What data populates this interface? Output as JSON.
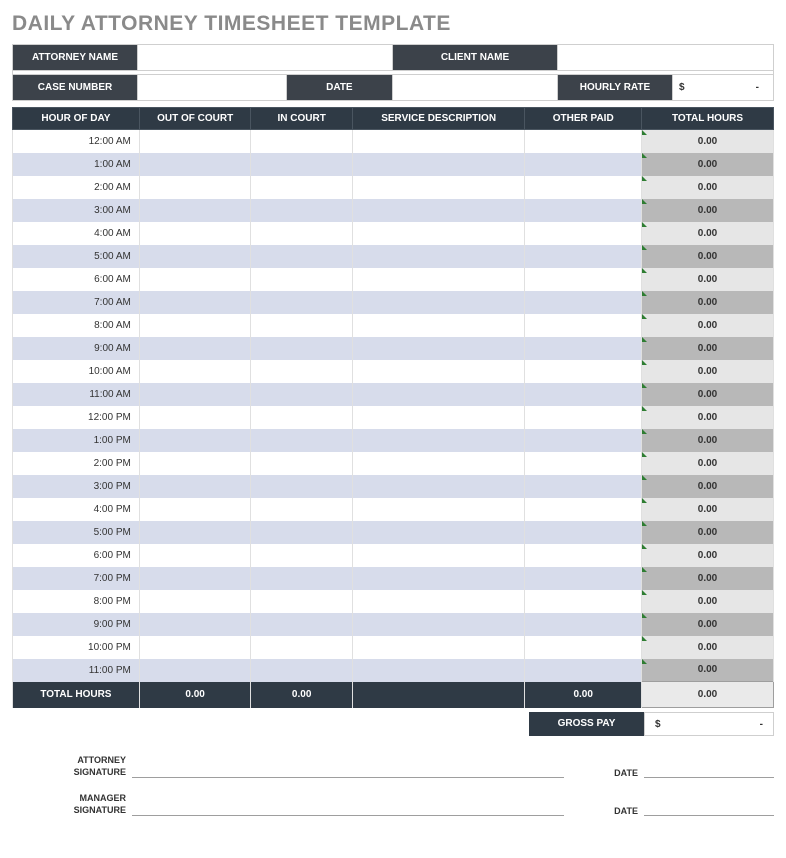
{
  "title": "DAILY ATTORNEY TIMESHEET TEMPLATE",
  "header": {
    "attorney_name_label": "ATTORNEY NAME",
    "client_name_label": "CLIENT NAME",
    "case_number_label": "CASE NUMBER",
    "date_label": "DATE",
    "hourly_rate_label": "HOURLY RATE",
    "hourly_rate_currency": "$",
    "hourly_rate_value": "-",
    "attorney_name_value": "",
    "client_name_value": "",
    "case_number_value": "",
    "date_value": ""
  },
  "columns": {
    "hour": "HOUR OF DAY",
    "out": "OUT OF COURT",
    "in": "IN COURT",
    "desc": "SERVICE DESCRIPTION",
    "other": "OTHER PAID",
    "total": "TOTAL HOURS"
  },
  "rows": [
    {
      "hour": "12:00 AM",
      "out": "",
      "in": "",
      "desc": "",
      "other": "",
      "total": "0.00"
    },
    {
      "hour": "1:00 AM",
      "out": "",
      "in": "",
      "desc": "",
      "other": "",
      "total": "0.00"
    },
    {
      "hour": "2:00 AM",
      "out": "",
      "in": "",
      "desc": "",
      "other": "",
      "total": "0.00"
    },
    {
      "hour": "3:00 AM",
      "out": "",
      "in": "",
      "desc": "",
      "other": "",
      "total": "0.00"
    },
    {
      "hour": "4:00 AM",
      "out": "",
      "in": "",
      "desc": "",
      "other": "",
      "total": "0.00"
    },
    {
      "hour": "5:00 AM",
      "out": "",
      "in": "",
      "desc": "",
      "other": "",
      "total": "0.00"
    },
    {
      "hour": "6:00 AM",
      "out": "",
      "in": "",
      "desc": "",
      "other": "",
      "total": "0.00"
    },
    {
      "hour": "7:00 AM",
      "out": "",
      "in": "",
      "desc": "",
      "other": "",
      "total": "0.00"
    },
    {
      "hour": "8:00 AM",
      "out": "",
      "in": "",
      "desc": "",
      "other": "",
      "total": "0.00"
    },
    {
      "hour": "9:00 AM",
      "out": "",
      "in": "",
      "desc": "",
      "other": "",
      "total": "0.00"
    },
    {
      "hour": "10:00 AM",
      "out": "",
      "in": "",
      "desc": "",
      "other": "",
      "total": "0.00"
    },
    {
      "hour": "11:00 AM",
      "out": "",
      "in": "",
      "desc": "",
      "other": "",
      "total": "0.00"
    },
    {
      "hour": "12:00 PM",
      "out": "",
      "in": "",
      "desc": "",
      "other": "",
      "total": "0.00"
    },
    {
      "hour": "1:00 PM",
      "out": "",
      "in": "",
      "desc": "",
      "other": "",
      "total": "0.00"
    },
    {
      "hour": "2:00 PM",
      "out": "",
      "in": "",
      "desc": "",
      "other": "",
      "total": "0.00"
    },
    {
      "hour": "3:00 PM",
      "out": "",
      "in": "",
      "desc": "",
      "other": "",
      "total": "0.00"
    },
    {
      "hour": "4:00 PM",
      "out": "",
      "in": "",
      "desc": "",
      "other": "",
      "total": "0.00"
    },
    {
      "hour": "5:00 PM",
      "out": "",
      "in": "",
      "desc": "",
      "other": "",
      "total": "0.00"
    },
    {
      "hour": "6:00 PM",
      "out": "",
      "in": "",
      "desc": "",
      "other": "",
      "total": "0.00"
    },
    {
      "hour": "7:00 PM",
      "out": "",
      "in": "",
      "desc": "",
      "other": "",
      "total": "0.00"
    },
    {
      "hour": "8:00 PM",
      "out": "",
      "in": "",
      "desc": "",
      "other": "",
      "total": "0.00"
    },
    {
      "hour": "9:00 PM",
      "out": "",
      "in": "",
      "desc": "",
      "other": "",
      "total": "0.00"
    },
    {
      "hour": "10:00 PM",
      "out": "",
      "in": "",
      "desc": "",
      "other": "",
      "total": "0.00"
    },
    {
      "hour": "11:00 PM",
      "out": "",
      "in": "",
      "desc": "",
      "other": "",
      "total": "0.00"
    }
  ],
  "totals": {
    "label": "TOTAL HOURS",
    "out": "0.00",
    "in": "0.00",
    "desc": "",
    "other": "0.00",
    "total": "0.00"
  },
  "gross": {
    "label": "GROSS PAY",
    "currency": "$",
    "value": "-"
  },
  "signatures": {
    "attorney_label": "ATTORNEY\nSIGNATURE",
    "manager_label": "MANAGER\nSIGNATURE",
    "date_label": "DATE"
  }
}
